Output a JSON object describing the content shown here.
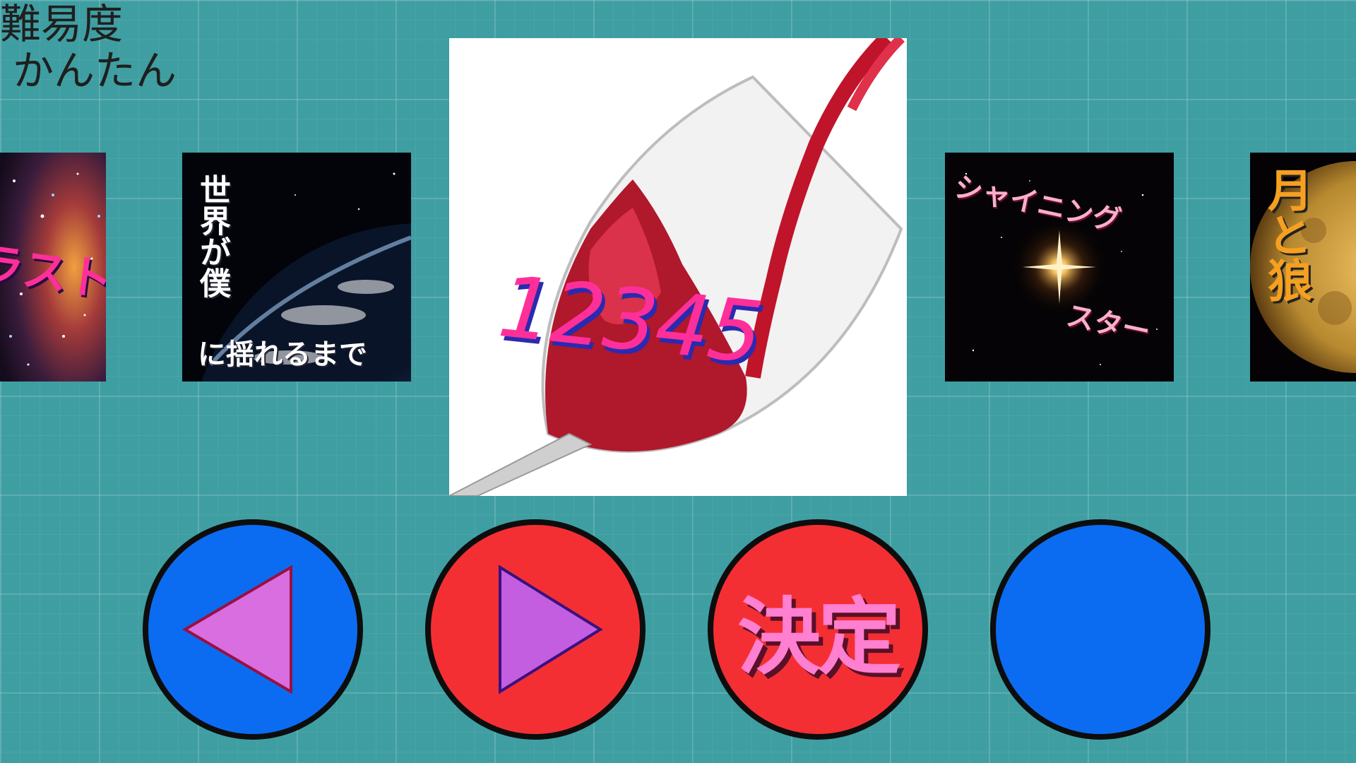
{
  "difficulty": {
    "label": "難易度",
    "value": "かんたん"
  },
  "songs": {
    "left_partial": {
      "title_fragment": "ラスト"
    },
    "prev": {
      "title_line1": "世界が僕",
      "title_line2": "に揺れるまで"
    },
    "selected": {
      "title": "12345"
    },
    "next": {
      "title_line1": "シャイニング",
      "title_line2": "スター"
    },
    "right_partial": {
      "title_fragment": "月と狼"
    }
  },
  "buttons": {
    "prev_icon": "triangle-left-icon",
    "next_icon": "triangle-right-icon",
    "decide_label": "決定",
    "blank": ""
  },
  "colors": {
    "background": "#3f9ea2",
    "blue_button": "#0b6cf2",
    "red_button": "#f42f33",
    "arrow_fill": "#d86ee0",
    "title_pink": "#ff2f9a"
  }
}
